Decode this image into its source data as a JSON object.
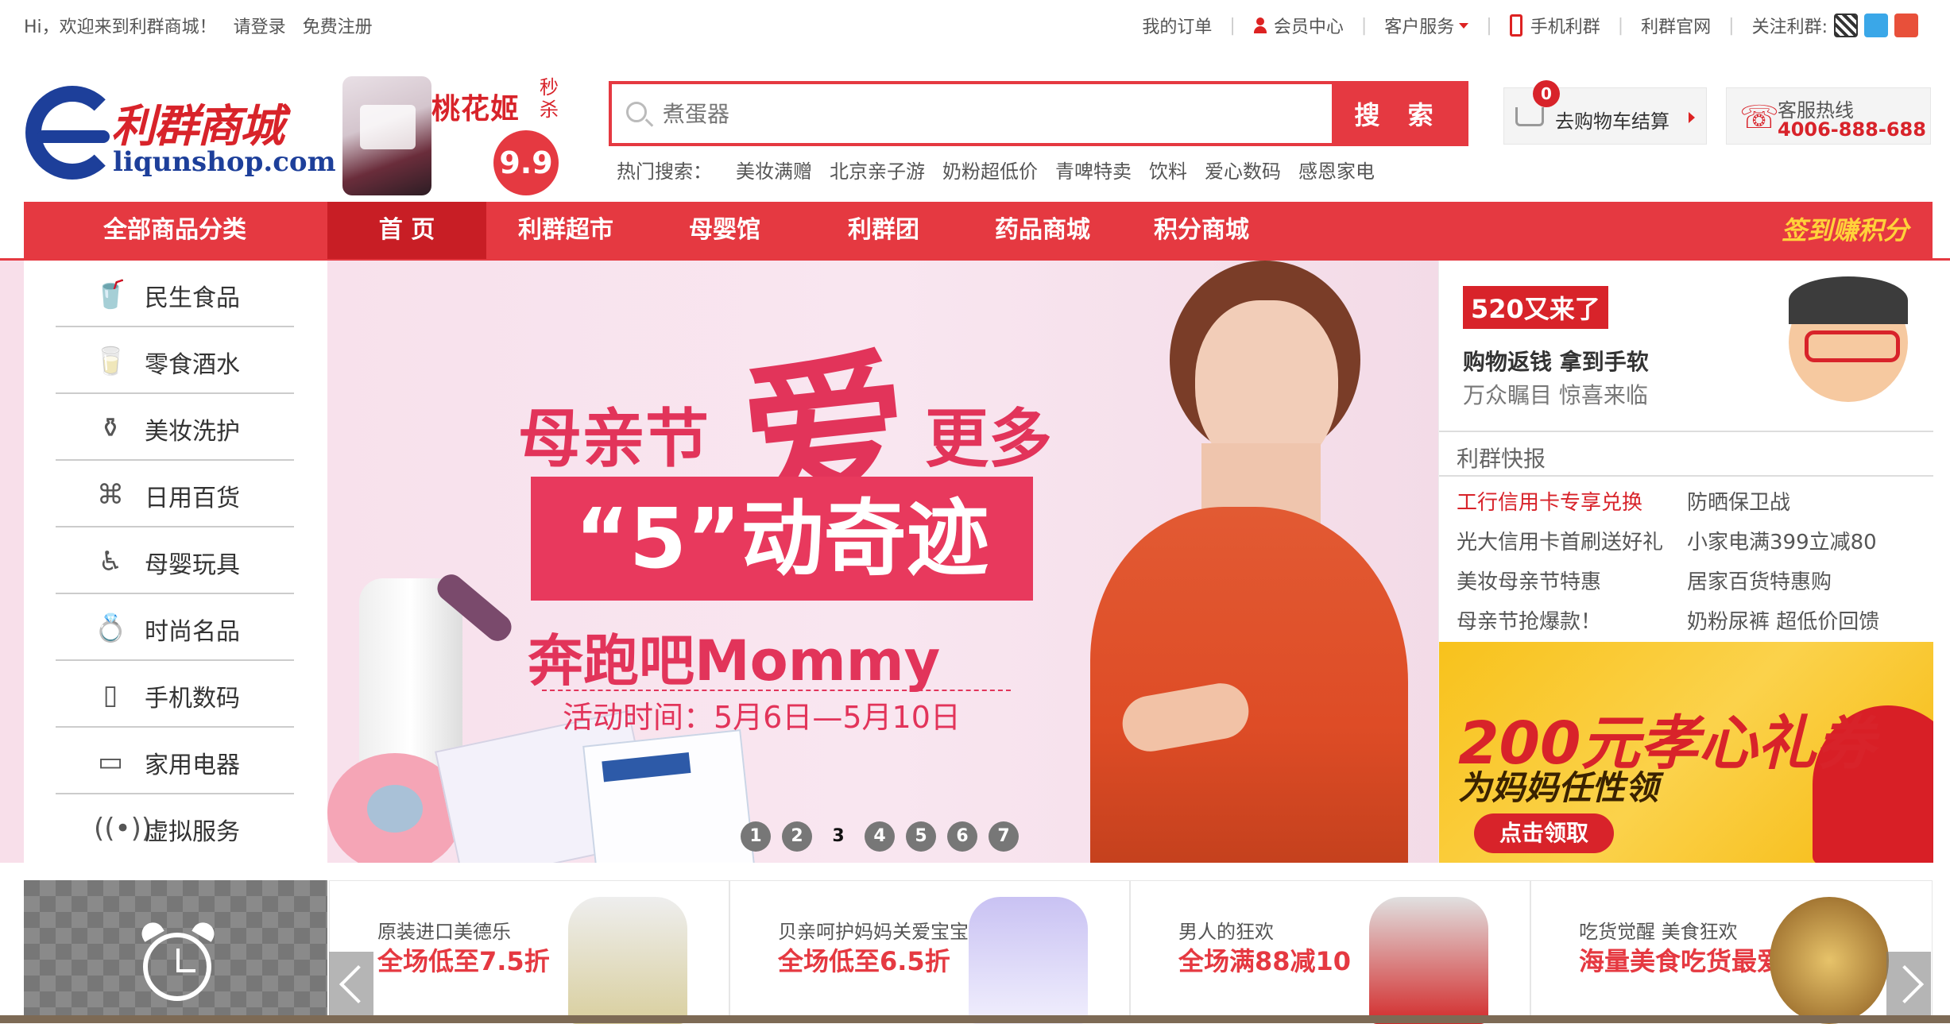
{
  "topbar": {
    "welcome": "Hi，欢迎来到利群商城！",
    "login": "请登录",
    "register": "免费注册",
    "links": [
      "我的订单",
      "会员中心",
      "客户服务",
      "手机利群",
      "利群官网",
      "关注利群:"
    ]
  },
  "logo": {
    "cn": "利群商城",
    "en": "liqunshop.com"
  },
  "promo": {
    "title": "桃花姬",
    "tag": "秒杀",
    "price": "9.9"
  },
  "search": {
    "placeholder": "煮蛋器",
    "button": "搜 索",
    "hot_label": "热门搜索：",
    "hot_terms": [
      "美妆满赠",
      "北京亲子游",
      "奶粉超低价",
      "青啤特卖",
      "饮料",
      "爱心数码",
      "感恩家电"
    ]
  },
  "cart": {
    "count": "0",
    "label": "去购物车结算"
  },
  "hotline": {
    "label": "客服热线",
    "number": "4006-888-688"
  },
  "nav": {
    "all": "全部商品分类",
    "items": [
      "首 页",
      "利群超市",
      "母婴馆",
      "利群团",
      "药品商城",
      "积分商城"
    ],
    "active_index": 0,
    "sign": "签到赚积分"
  },
  "categories": [
    {
      "label": "民生食品",
      "icon": "bowl-icon"
    },
    {
      "label": "零食酒水",
      "icon": "drink-icon"
    },
    {
      "label": "美妆洗护",
      "icon": "perfume-icon"
    },
    {
      "label": "日用百货",
      "icon": "box-icon"
    },
    {
      "label": "母婴玩具",
      "icon": "stroller-icon"
    },
    {
      "label": "时尚名品",
      "icon": "ring-icon"
    },
    {
      "label": "手机数码",
      "icon": "phone-icon"
    },
    {
      "label": "家用电器",
      "icon": "monitor-icon"
    },
    {
      "label": "虚拟服务",
      "icon": "signal-icon"
    }
  ],
  "banner": {
    "title_left": "母亲节",
    "title_big": "爱",
    "title_right": "更多",
    "box": "“5”动奇迹",
    "run": "奔跑吧Mommy",
    "date": "活动时间：5月6日—5月10日",
    "dots": [
      "1",
      "2",
      "3",
      "4",
      "5",
      "6",
      "7"
    ],
    "active_dot": 2
  },
  "right_ad": {
    "tag": "520又来了",
    "line1": "购物返钱 拿到手软",
    "line2": "万众瞩目 惊喜来临"
  },
  "news": {
    "title": "利群快报",
    "items": [
      "工行信用卡专享兑换",
      "防晒保卫战",
      "光大信用卡首刷送好礼",
      "小家电满399立减80",
      "美妆母亲节特惠",
      "居家百货特惠购",
      "母亲节抢爆款！",
      "奶粉尿裤 超低价回馈"
    ],
    "highlight_color": "#d8232a"
  },
  "coupon": {
    "title": "200元孝心礼券",
    "sub": "为妈妈任性领",
    "button": "点击领取"
  },
  "tiles": [
    {
      "line1": "原装进口美德乐",
      "line2": "全场低至7.5折"
    },
    {
      "line1": "贝亲呵护妈妈关爱宝宝",
      "line2": "全场低至6.5折"
    },
    {
      "line1": "男人的狂欢",
      "line2": "全场满88减10"
    },
    {
      "line1": "吃货觉醒 美食狂欢",
      "line2": "海量美食吃货最爱"
    }
  ],
  "colors": {
    "brand_red": "#e53941",
    "logo_blue": "#1d3f9a",
    "sign_yellow": "#ffd23a"
  }
}
